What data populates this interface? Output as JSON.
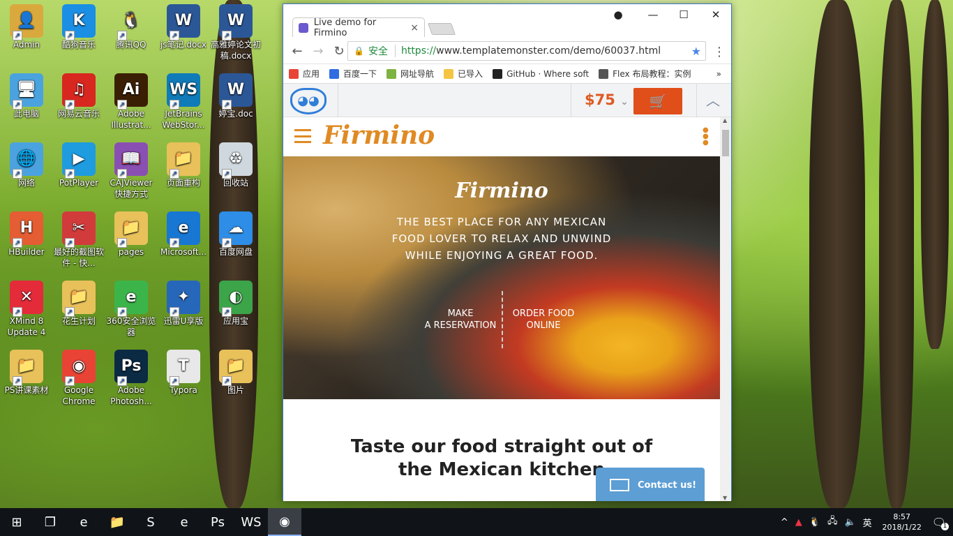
{
  "desktop": {
    "icons": [
      {
        "label": "Admin",
        "glyph": "👤",
        "bg": "#d9a93e"
      },
      {
        "label": "酷狗音乐",
        "glyph": "K",
        "bg": "#1a8fe3"
      },
      {
        "label": "腾讯QQ",
        "glyph": "🐧",
        "bg": "transparent"
      },
      {
        "label": "js笔记.docx",
        "glyph": "W",
        "bg": "#2b5797"
      },
      {
        "label": "高雅婷论文初稿.docx",
        "glyph": "W",
        "bg": "#2b5797"
      },
      {
        "label": "此电脑",
        "glyph": "🖥",
        "bg": "#4aa3df"
      },
      {
        "label": "网易云音乐",
        "glyph": "♫",
        "bg": "#d7271f"
      },
      {
        "label": "Adobe Illustrat...",
        "glyph": "Ai",
        "bg": "#3b1f05"
      },
      {
        "label": "JetBrains WebStor...",
        "glyph": "WS",
        "bg": "#0f7bb9"
      },
      {
        "label": "婷宝.doc",
        "glyph": "W",
        "bg": "#2b5797"
      },
      {
        "label": "网络",
        "glyph": "🌐",
        "bg": "#4aa3df"
      },
      {
        "label": "PotPlayer",
        "glyph": "▶",
        "bg": "#1f9be0"
      },
      {
        "label": "CAJViewer 快捷方式",
        "glyph": "📖",
        "bg": "#8a4fb2"
      },
      {
        "label": "页面重构",
        "glyph": "📁",
        "bg": "#e8c15b"
      },
      {
        "label": "回收站",
        "glyph": "♻",
        "bg": "#cfd8df"
      },
      {
        "label": "HBuilder",
        "glyph": "H",
        "bg": "#e45d33"
      },
      {
        "label": "最好的截图软件 - 快...",
        "glyph": "✂",
        "bg": "#d23b3b"
      },
      {
        "label": "pages",
        "glyph": "📁",
        "bg": "#e8c15b"
      },
      {
        "label": "Microsoft...",
        "glyph": "e",
        "bg": "#1877d2"
      },
      {
        "label": "百度网盘",
        "glyph": "☁",
        "bg": "#2e8de6"
      },
      {
        "label": "XMind 8 Update 4",
        "glyph": "✕",
        "bg": "#e32b3a"
      },
      {
        "label": "花生计划",
        "glyph": "📁",
        "bg": "#e8c15b"
      },
      {
        "label": "360安全浏览器",
        "glyph": "e",
        "bg": "#3bb54a"
      },
      {
        "label": "迅雷U享版",
        "glyph": "✦",
        "bg": "#2767b9"
      },
      {
        "label": "应用宝",
        "glyph": "◐",
        "bg": "#3ca449"
      },
      {
        "label": "PS讲课素材",
        "glyph": "📁",
        "bg": "#e8c15b"
      },
      {
        "label": "Google Chrome",
        "glyph": "◉",
        "bg": "#e84335"
      },
      {
        "label": "Adobe Photosh...",
        "glyph": "Ps",
        "bg": "#0b2a44"
      },
      {
        "label": "Typora",
        "glyph": "T",
        "bg": "#e8e8e8"
      },
      {
        "label": "图片",
        "glyph": "📁",
        "bg": "#e8c15b"
      }
    ]
  },
  "browser": {
    "tab_title": "Live demo for Firmino",
    "tab_close": "×",
    "window_buttons": {
      "account": "●",
      "minimize": "—",
      "maximize": "☐",
      "close": "✕"
    },
    "nav": {
      "back": "←",
      "forward": "→",
      "reload": "↻"
    },
    "omnibox": {
      "lock": "🔒",
      "secure_label": "安全",
      "url_scheme": "https://",
      "url_host": "www.templatemonster.com",
      "url_path": "/demo/60037.html",
      "star": "★"
    },
    "menu": "⋮",
    "bookmarks": [
      {
        "label": "应用",
        "color": "#e94335"
      },
      {
        "label": "百度一下",
        "color": "#2f6de1"
      },
      {
        "label": "网址导航",
        "color": "#7cb342"
      },
      {
        "label": "已导入",
        "color": "#f4c542"
      },
      {
        "label": "GitHub · Where soft",
        "color": "#222"
      },
      {
        "label": "Flex 布局教程：实例",
        "color": "#555"
      }
    ],
    "bookmarks_more": "»"
  },
  "templatemonster": {
    "logo": "◕◕",
    "price": "$75",
    "price_caret": "⌄",
    "cart_icon": "🛒",
    "collapse_icon": "︿"
  },
  "site": {
    "brand": "Firmino",
    "menu_dots": "•\n•\n•",
    "hero": {
      "title": "Firmino",
      "subtitle": "THE BEST PLACE FOR ANY MEXICAN FOOD LOVER TO RELAX AND UNWIND WHILE ENJOYING A GREAT FOOD.",
      "button_reservation_line1": "MAKE",
      "button_reservation_line2": "A RESERVATION",
      "button_order_line1": "ORDER FOOD",
      "button_order_line2": "ONLINE"
    },
    "section_title_line1": "Taste our food straight out of",
    "section_title_line2": "the Mexican kitchen",
    "contact_label": "Contact us!"
  },
  "taskbar": {
    "start": "⊞",
    "apps": [
      {
        "name": "task-view",
        "glyph": "❐"
      },
      {
        "name": "edge",
        "glyph": "e"
      },
      {
        "name": "file-explorer",
        "glyph": "📁"
      },
      {
        "name": "sublime",
        "glyph": "S"
      },
      {
        "name": "360-browser",
        "glyph": "e"
      },
      {
        "name": "photoshop",
        "glyph": "Ps"
      },
      {
        "name": "webstorm",
        "glyph": "WS"
      },
      {
        "name": "chrome",
        "glyph": "◉"
      }
    ],
    "tray": {
      "caret": "^",
      "ime": "英",
      "time": "8:57",
      "date": "2018/1/22",
      "notification_count": "1"
    }
  }
}
